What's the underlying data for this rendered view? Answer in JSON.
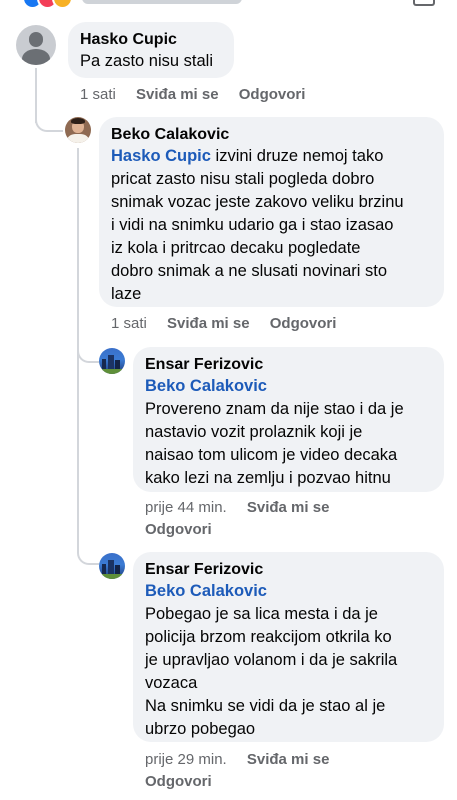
{
  "comments": [
    {
      "author": "Hasko Cupic",
      "text": "Pa zasto nisu stali",
      "time": "1 sati",
      "like": "Sviđa mi se",
      "reply": "Odgovori"
    },
    {
      "author": "Beko Calakovic",
      "mention": "Hasko Cupic",
      "lines": [
        " izvini druze nemoj tako",
        "pricat zasto nisu stali pogleda dobro",
        "snimak vozac jeste zakovo veliku brzinu",
        "i vidi na snimku udario ga i stao izasao",
        "iz kola i pritrcao decaku pogledate",
        "dobro snimak a ne slusati novinari sto",
        "laze"
      ],
      "time": "1 sati",
      "like": "Sviđa mi se",
      "reply": "Odgovori"
    },
    {
      "author": "Ensar Ferizovic",
      "mention": "Beko Calakovic",
      "lines": [
        "Provereno znam da nije stao i da je",
        "nastavio vozit prolaznik koji je",
        "naisao tom ulicom je video decaka",
        "kako lezi na zemlju i pozvao hitnu"
      ],
      "time": "prije 44 min.",
      "like": "Sviđa mi se",
      "reply": "Odgovori"
    },
    {
      "author": "Ensar Ferizovic",
      "mention": "Beko Calakovic",
      "lines": [
        "Pobegao je sa lica mesta i da je",
        "policija brzom reakcijom otkrila ko",
        "je upravljao volanom i da je sakrila",
        "vozaca",
        "Na snimku se vidi da je stao al je",
        "ubrzo pobegao"
      ],
      "time": "prije 29 min.",
      "like": "Sviđa mi se",
      "reply": "Odgovori"
    }
  ],
  "colors": {
    "bubble": "#f0f2f5",
    "mention": "#1d5bb9",
    "meta": "#65676b",
    "reactions": [
      "#1877f2",
      "#f33e58",
      "#f7b125"
    ]
  },
  "icons": [
    "default-avatar-icon",
    "profile-photo-avatar",
    "city-photo-avatar",
    "reaction-like-icon",
    "reaction-love-icon",
    "reaction-haha-icon"
  ]
}
